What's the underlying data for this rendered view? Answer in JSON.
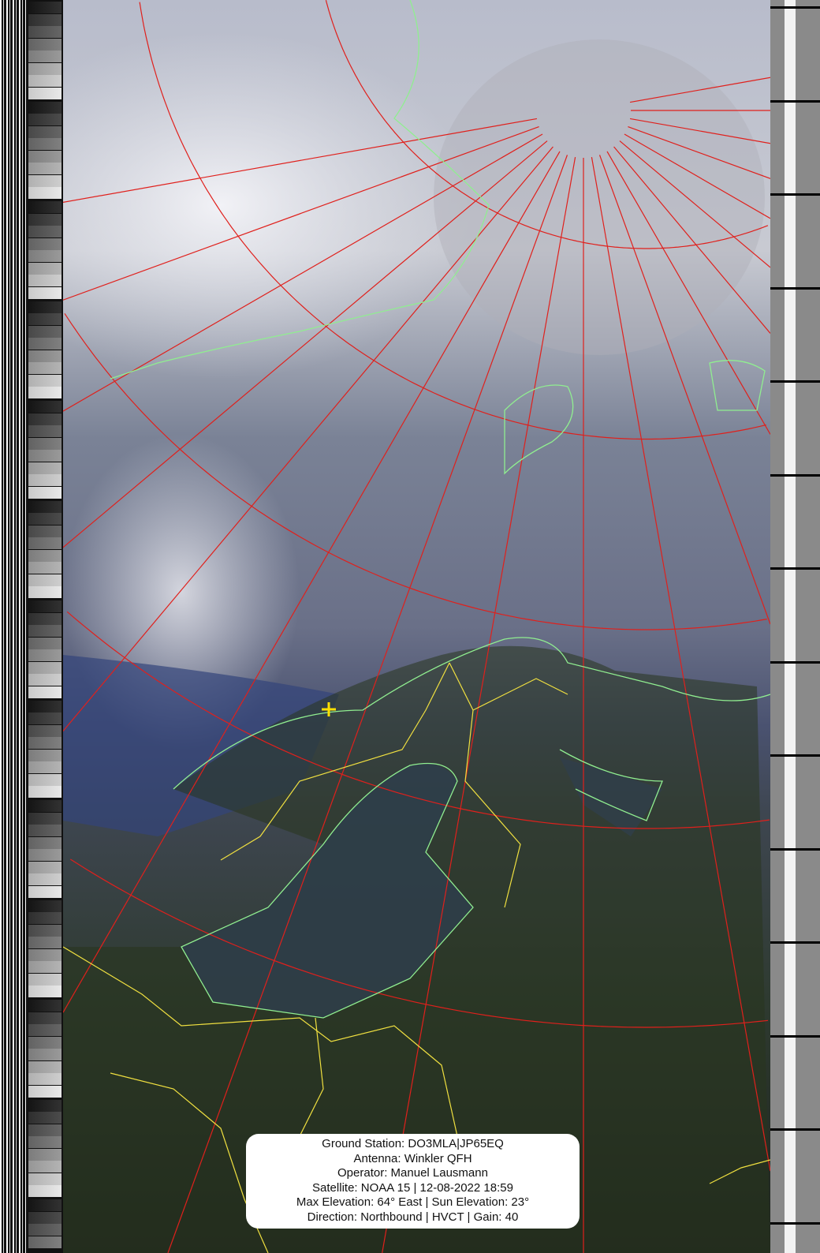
{
  "info_box": {
    "lines": [
      "Ground Station: DO3MLA|JP65EQ",
      "Antenna: Winkler QFH",
      "Operator: Manuel Lausmann",
      "Satellite: NOAA 15 | 12-08-2022 18:59",
      "Max Elevation: 64° East | Sun Elevation: 23°",
      "Direction: Northbound | HVCT | Gain: 40"
    ]
  },
  "colors": {
    "grid": "#e0201c",
    "coast": "#90ee90",
    "borders": "#f0e040",
    "marker": "#ffe000"
  }
}
